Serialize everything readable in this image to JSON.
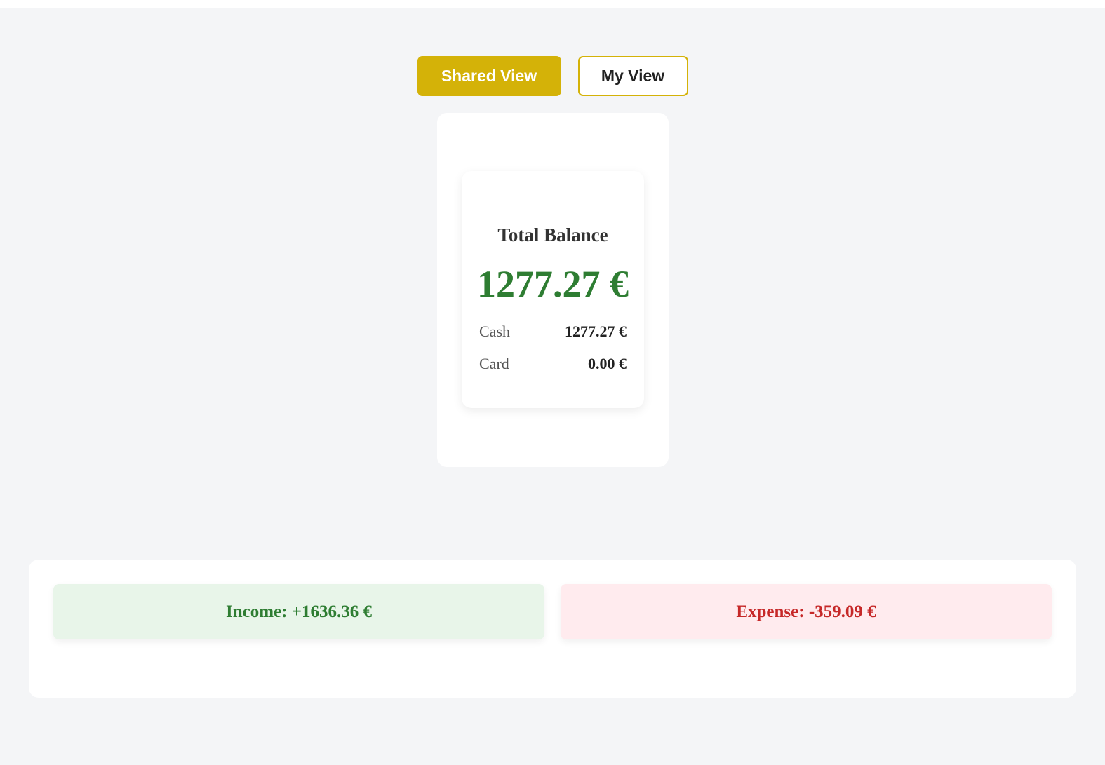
{
  "tabs": {
    "shared_label": "Shared View",
    "my_label": "My View",
    "active": "Shared View"
  },
  "balance": {
    "title": "Total Balance",
    "amount": "1277.27 €",
    "cash_label": "Cash",
    "cash_value": "1277.27 €",
    "card_label": "Card",
    "card_value": "0.00 €"
  },
  "summary": {
    "income": "Income: +1636.36 €",
    "expense": "Expense: -359.09 €"
  },
  "colors": {
    "accent": "#d4b208",
    "positive": "#2e7d32",
    "negative": "#c62828",
    "income_bg": "#e8f5e9",
    "expense_bg": "#ffebee"
  }
}
